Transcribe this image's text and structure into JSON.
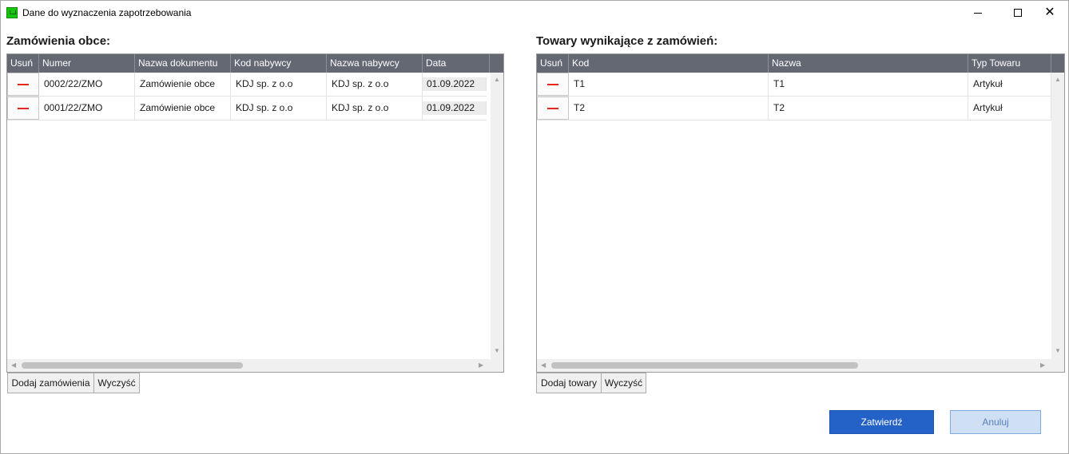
{
  "window": {
    "title": "Dane do wyznaczenia zapotrzebowania",
    "minimize_glyph": "—",
    "maximize_glyph": "☐",
    "close_glyph": "✕"
  },
  "orders": {
    "section_title": "Zamówienia obce:",
    "columns": [
      "Usuń",
      "Numer",
      "Nazwa dokumentu",
      "Kod nabywcy",
      "Nazwa nabywcy",
      "Data"
    ],
    "rows": [
      {
        "numer": "0002/22/ZMO",
        "nazwa_dokumentu": "Zamówienie obce",
        "kod_nabywcy": "KDJ sp. z o.o",
        "nazwa_nabywcy": "KDJ sp. z o.o",
        "data": "01.09.2022"
      },
      {
        "numer": "0001/22/ZMO",
        "nazwa_dokumentu": "Zamówienie obce",
        "kod_nabywcy": "KDJ sp. z o.o",
        "nazwa_nabywcy": "KDJ sp. z o.o",
        "data": "01.09.2022"
      }
    ],
    "add_button": "Dodaj zamówienia",
    "clear_button": "Wyczyść"
  },
  "goods": {
    "section_title": "Towary wynikające z zamówień:",
    "columns": [
      "Usuń",
      "Kod",
      "Nazwa",
      "Typ Towaru"
    ],
    "rows": [
      {
        "kod": "T1",
        "nazwa": "T1",
        "typ": "Artykuł"
      },
      {
        "kod": "T2",
        "nazwa": "T2",
        "typ": "Artykuł"
      }
    ],
    "add_button": "Dodaj towary",
    "clear_button": "Wyczyść"
  },
  "footer": {
    "confirm_button": "Zatwierdź",
    "cancel_button": "Anuluj"
  },
  "colors": {
    "header_bg": "#646873",
    "delete_mark": "#e8261b",
    "primary_button": "#2462c8",
    "secondary_button": "#cfe0f5",
    "app_icon": "#16c60c"
  },
  "icons": {
    "app": "app-icon",
    "delete": "remove-row-icon"
  }
}
